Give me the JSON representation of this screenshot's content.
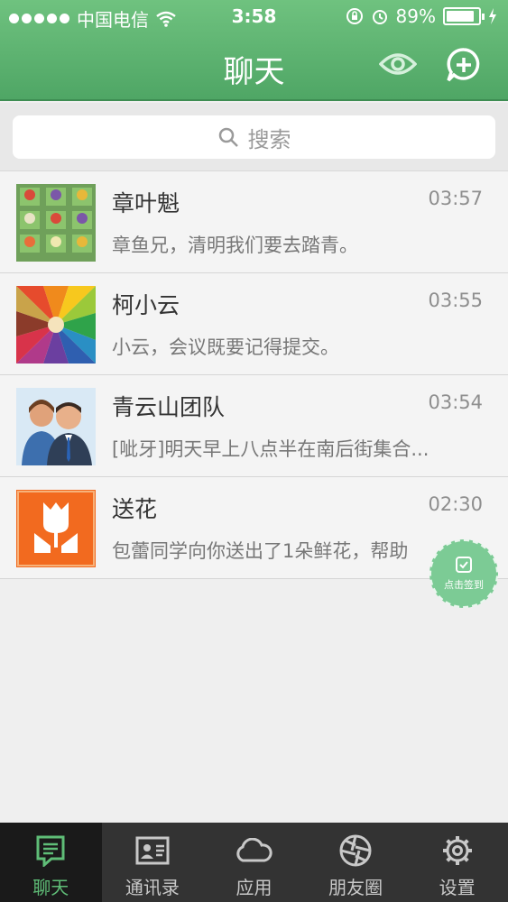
{
  "status": {
    "carrier": "中国电信",
    "time": "3:58",
    "battery": "89%",
    "battery_level": 0.89
  },
  "header": {
    "title": "聊天"
  },
  "search": {
    "placeholder": "搜索"
  },
  "chats": [
    {
      "name": "章叶魁",
      "time": "03:57",
      "message": "章鱼兄，清明我们要去踏青。"
    },
    {
      "name": "柯小云",
      "time": "03:55",
      "message": "小云，会议既要记得提交。"
    },
    {
      "name": "青云山团队",
      "time": "03:54",
      "message": "[呲牙]明天早上八点半在南后街集合..."
    },
    {
      "name": "送花",
      "time": "02:30",
      "message": "包蕾同学向你送出了1朵鲜花，帮助"
    }
  ],
  "checkin": {
    "label": "点击签到"
  },
  "tabs": [
    {
      "label": "聊天",
      "icon": "chat-icon",
      "active": true
    },
    {
      "label": "通讯录",
      "icon": "contacts-icon",
      "active": false
    },
    {
      "label": "应用",
      "icon": "cloud-icon",
      "active": false
    },
    {
      "label": "朋友圈",
      "icon": "aperture-icon",
      "active": false
    },
    {
      "label": "设置",
      "icon": "gear-icon",
      "active": false
    }
  ],
  "colors": {
    "header_green": "#5bb06f",
    "accent_green": "#5fbd77",
    "tabbar": "#333333"
  }
}
